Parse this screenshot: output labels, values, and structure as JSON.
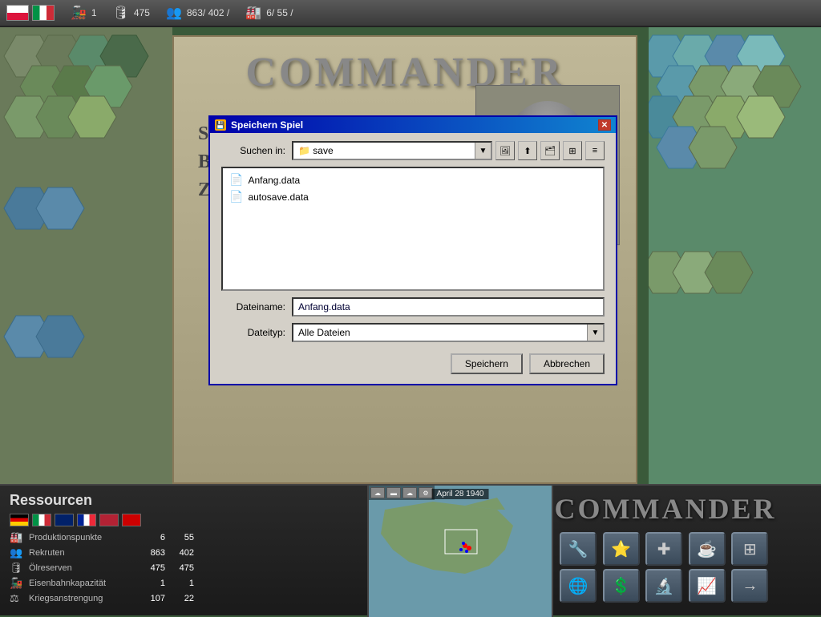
{
  "topbar": {
    "stat_train": "1",
    "stat_supply": "475",
    "stat_manpower": "863/ 402 /",
    "stat_industry": "6/ 55 /"
  },
  "gamemenu": {
    "title": "Commander",
    "item1": "Speichern",
    "item2": "Beenden",
    "item3": "Zu"
  },
  "dialog": {
    "title": "Speichern Spiel",
    "search_label": "Suchen in:",
    "search_value": "save",
    "files": [
      {
        "name": "Anfang.data"
      },
      {
        "name": "autosave.data"
      }
    ],
    "filename_label": "Dateiname:",
    "filename_value": "Anfang.data",
    "filetype_label": "Dateityp:",
    "filetype_value": "Alle Dateien",
    "save_btn": "Speichern",
    "cancel_btn": "Abbrechen"
  },
  "resources": {
    "title": "Ressourcen",
    "rows": [
      {
        "icon": "🏭",
        "name": "Produktionspunkte",
        "val1": "6",
        "val2": "55"
      },
      {
        "icon": "👥",
        "name": "Rekruten",
        "val1": "863",
        "val2": "402"
      },
      {
        "icon": "🛢",
        "name": "Ölreserven",
        "val1": "475",
        "val2": "475"
      },
      {
        "icon": "🚂",
        "name": "Eisenbahnkapazität",
        "val1": "1",
        "val2": "1"
      },
      {
        "icon": "⚖",
        "name": "Kriegsanstrengung",
        "val1": "107",
        "val2": "22"
      }
    ]
  },
  "minimap": {
    "date": "April 28 1940"
  },
  "commander_panel": {
    "title": "COMMANDER",
    "buttons": [
      {
        "icon": "🔧",
        "name": "wrench-btn"
      },
      {
        "icon": "⭐",
        "name": "star-btn"
      },
      {
        "icon": "✚",
        "name": "plus-btn"
      },
      {
        "icon": "☕",
        "name": "coffee-btn"
      },
      {
        "icon": "≡",
        "name": "grid-btn"
      },
      {
        "icon": "🌐",
        "name": "globe-btn"
      },
      {
        "icon": "💲",
        "name": "dollar-btn"
      },
      {
        "icon": "🔬",
        "name": "research-btn"
      },
      {
        "icon": "📈",
        "name": "chart-btn"
      },
      {
        "icon": "→",
        "name": "arrow-btn"
      }
    ]
  }
}
